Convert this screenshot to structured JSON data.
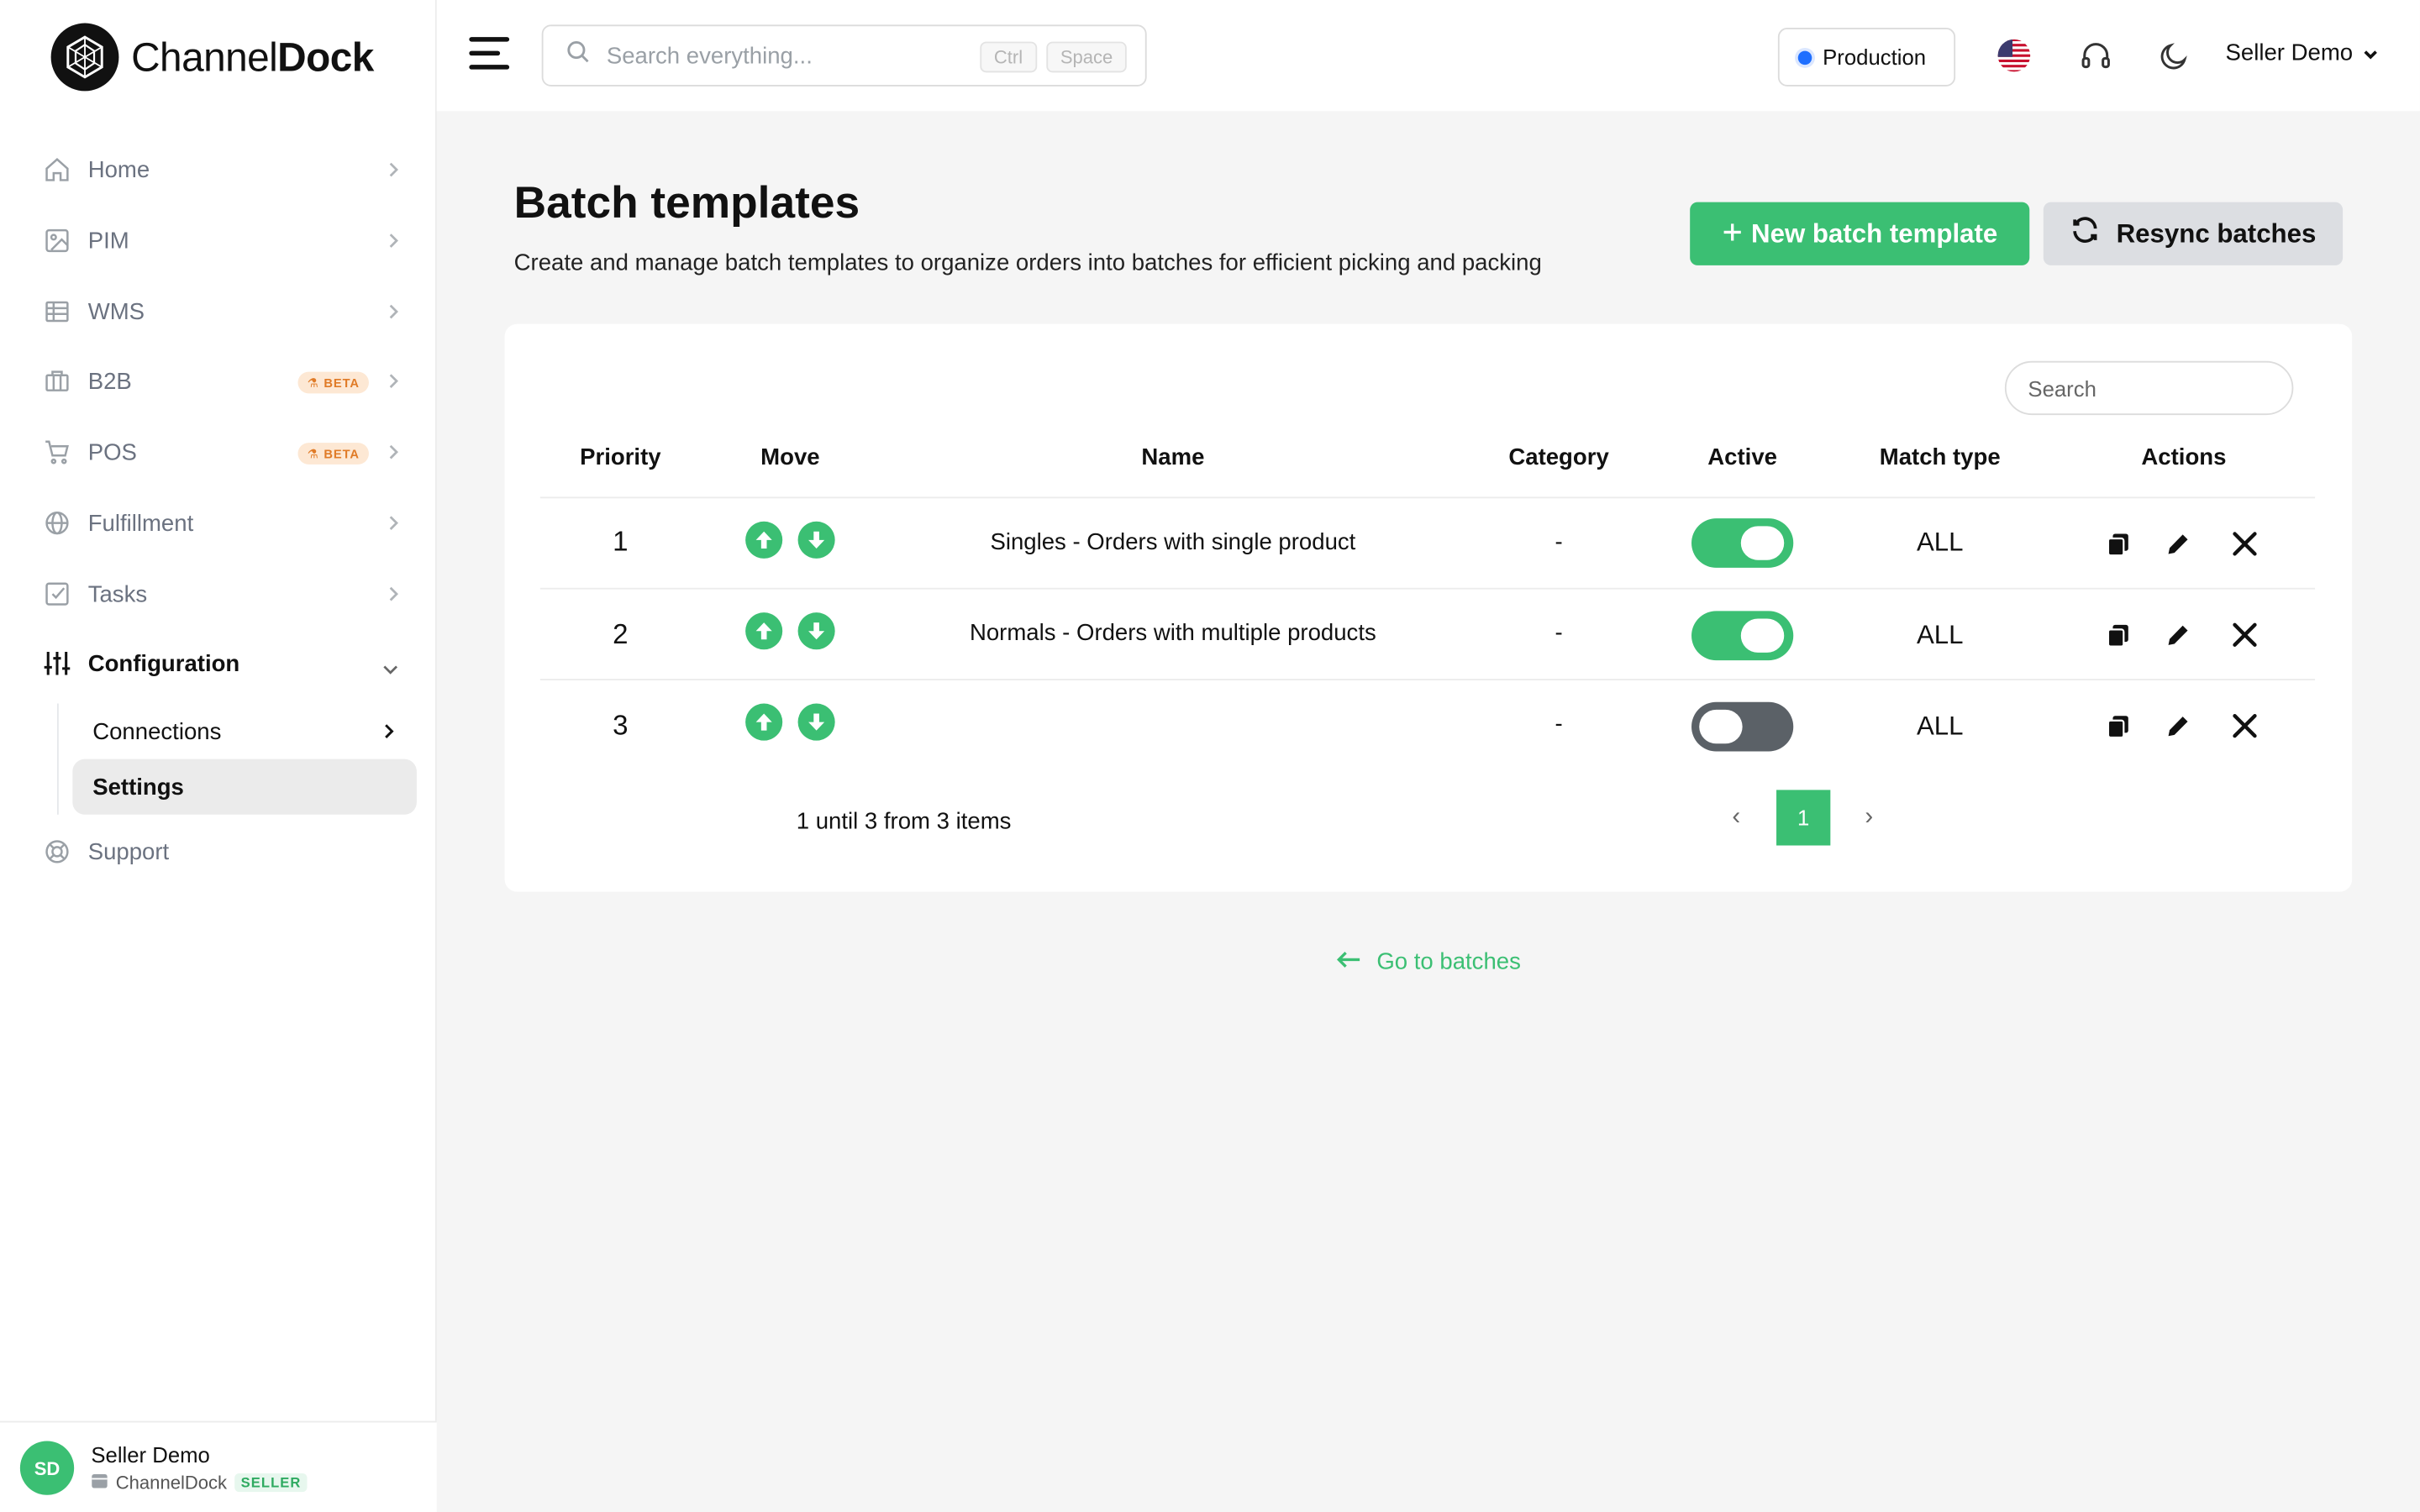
{
  "brand": {
    "name_regular": "Channel",
    "name_bold": "Dock"
  },
  "colors": {
    "accent": "#3bbf73",
    "env_dot": "#1f6fff",
    "beta_bg": "#fde8d4",
    "beta_text": "#e07b27",
    "toggle_off": "#5b6167"
  },
  "sidebar": {
    "items": [
      {
        "label": "Home",
        "icon": "home-icon"
      },
      {
        "label": "PIM",
        "icon": "image-icon"
      },
      {
        "label": "WMS",
        "icon": "grid-icon"
      },
      {
        "label": "B2B",
        "icon": "briefcase-icon",
        "badge": "BETA"
      },
      {
        "label": "POS",
        "icon": "cart-icon",
        "badge": "BETA"
      },
      {
        "label": "Fulfillment",
        "icon": "globe-icon"
      },
      {
        "label": "Tasks",
        "icon": "checkbox-icon"
      },
      {
        "label": "Configuration",
        "icon": "sliders-icon",
        "expanded": true
      },
      {
        "label": "Support",
        "icon": "lifebuoy-icon"
      }
    ],
    "subitems": [
      {
        "label": "Connections"
      },
      {
        "label": "Settings",
        "selected": true
      }
    ],
    "user": {
      "initials": "SD",
      "name": "Seller Demo",
      "org": "ChannelDock",
      "role": "SELLER"
    }
  },
  "topbar": {
    "search_placeholder": "Search everything...",
    "kbd1": "Ctrl",
    "kbd2": "Space",
    "environment": "Production",
    "user_menu": "Seller Demo"
  },
  "page": {
    "title": "Batch templates",
    "subtitle": "Create and manage batch templates to organize orders into batches for efficient picking and packing",
    "new_button": "New batch template",
    "resync_button": "Resync batches",
    "table_search_placeholder": "Search",
    "columns": [
      "Priority",
      "Move",
      "Name",
      "Category",
      "Active",
      "Match type",
      "Actions"
    ],
    "rows": [
      {
        "priority": "1",
        "name": "Singles - Orders with single product",
        "category": "-",
        "active": true,
        "match_type": "ALL"
      },
      {
        "priority": "2",
        "name": "Normals - Orders with multiple products",
        "category": "-",
        "active": true,
        "match_type": "ALL"
      },
      {
        "priority": "3",
        "name": "",
        "category": "-",
        "active": false,
        "match_type": "ALL"
      }
    ],
    "pagination": {
      "info": "1 until 3 from 3 items",
      "current_page": "1",
      "prev": "‹",
      "next": "›"
    },
    "back_link": "Go to batches"
  }
}
